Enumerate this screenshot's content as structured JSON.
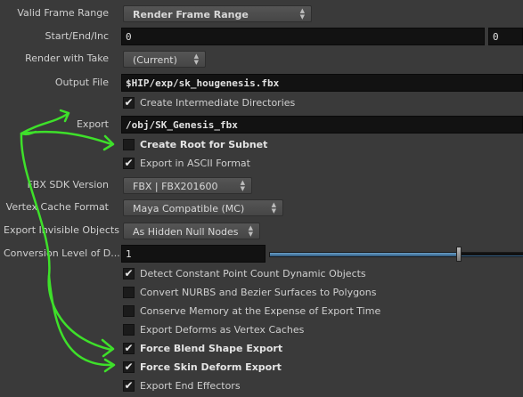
{
  "fields": {
    "valid_frame_range": {
      "label": "Valid Frame Range",
      "value": "Render Frame Range"
    },
    "start_end_inc": {
      "label": "Start/End/Inc",
      "start": "0",
      "end": "0"
    },
    "render_with_take": {
      "label": "Render with Take",
      "value": "(Current)"
    },
    "output_file": {
      "label": "Output File",
      "value": "$HIP/exp/sk_hougenesis.fbx"
    },
    "create_intermediate_dirs": {
      "label": "Create Intermediate Directories",
      "checked": true
    },
    "export": {
      "label": "Export",
      "value": "/obj/SK_Genesis_fbx"
    },
    "create_root_for_subnet": {
      "label": "Create Root for Subnet",
      "checked": false
    },
    "export_ascii": {
      "label": "Export in ASCII Format",
      "checked": true
    },
    "fbx_sdk_version": {
      "label": "FBX SDK Version",
      "value": "FBX | FBX201600"
    },
    "vertex_cache_format": {
      "label": "Vertex Cache Format",
      "value": "Maya Compatible (MC)"
    },
    "export_invisible_objects": {
      "label": "Export Invisible Objects",
      "value": "As Hidden Null Nodes"
    },
    "conversion_level": {
      "label": "Conversion Level of D...",
      "value": "1",
      "slider_fraction": 0.75
    },
    "detect_constant_point_count": {
      "label": "Detect Constant Point Count Dynamic Objects",
      "checked": true
    },
    "convert_nurbs": {
      "label": "Convert NURBS and Bezier Surfaces to Polygons",
      "checked": false
    },
    "conserve_memory": {
      "label": "Conserve Memory at the Expense of Export Time",
      "checked": false
    },
    "export_deforms_vertex_caches": {
      "label": "Export Deforms as Vertex Caches",
      "checked": false
    },
    "force_blend_shape_export": {
      "label": "Force Blend Shape Export",
      "checked": true
    },
    "force_skin_deform_export": {
      "label": "Force Skin Deform Export",
      "checked": true
    },
    "export_end_effectors": {
      "label": "Export End Effectors",
      "checked": true
    }
  },
  "icons": {
    "check": "✔",
    "updown": "▲▼",
    "annotation_color": "#3ee02a"
  }
}
